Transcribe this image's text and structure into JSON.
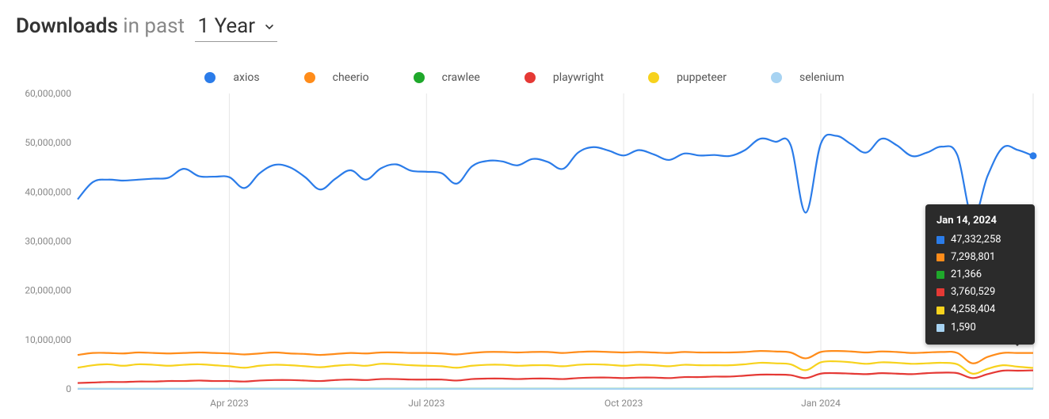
{
  "header": {
    "label_downloads": "Downloads",
    "label_in_past": "in past",
    "range_selected": "1 Year"
  },
  "legend": [
    {
      "name": "axios",
      "color": "#2b7ce9"
    },
    {
      "name": "cheerio",
      "color": "#ff8c1a"
    },
    {
      "name": "crawlee",
      "color": "#1fa82b"
    },
    {
      "name": "playwright",
      "color": "#e53935"
    },
    {
      "name": "puppeteer",
      "color": "#f7d21d"
    },
    {
      "name": "selenium",
      "color": "#a7d3f2"
    }
  ],
  "tooltip": {
    "date": "Jan 14, 2024",
    "rows": [
      {
        "color": "#2b7ce9",
        "value": "47,332,258"
      },
      {
        "color": "#ff8c1a",
        "value": "7,298,801"
      },
      {
        "color": "#1fa82b",
        "value": "21,366"
      },
      {
        "color": "#e53935",
        "value": "3,760,529"
      },
      {
        "color": "#f7d21d",
        "value": "4,258,404"
      },
      {
        "color": "#a7d3f2",
        "value": "1,590"
      }
    ]
  },
  "chart_data": {
    "type": "line",
    "xlabel": "",
    "ylabel": "",
    "ylim": [
      0,
      60000000
    ],
    "x_ticks": [
      "Apr 2023",
      "Jul 2023",
      "Oct 2023",
      "Jan 2024"
    ],
    "y_ticks": [
      0,
      10000000,
      20000000,
      30000000,
      40000000,
      50000000,
      60000000
    ],
    "series": [
      {
        "name": "axios",
        "color": "#2b7ce9",
        "values": [
          38500000,
          42000000,
          42500000,
          42300000,
          42500000,
          42700000,
          42900000,
          44700000,
          43200000,
          43100000,
          43000000,
          40800000,
          43800000,
          45500000,
          45000000,
          43000000,
          40500000,
          42700000,
          44400000,
          42500000,
          44800000,
          45600000,
          44300000,
          44100000,
          43800000,
          41700000,
          45200000,
          46300000,
          46200000,
          45400000,
          46700000,
          46100000,
          44700000,
          48000000,
          49100000,
          48400000,
          47400000,
          48500000,
          47600000,
          46500000,
          47800000,
          47400000,
          47500000,
          47300000,
          48500000,
          50800000,
          50200000,
          49600000,
          35800000,
          49800000,
          51400000,
          49700000,
          48000000,
          50800000,
          49500000,
          47300000,
          48000000,
          49200000,
          47500000,
          34800000,
          43300000,
          49000000,
          48500000,
          47332258
        ]
      },
      {
        "name": "cheerio",
        "color": "#ff8c1a",
        "values": [
          6900000,
          7300000,
          7300000,
          7200000,
          7400000,
          7300000,
          7200000,
          7300000,
          7400000,
          7300000,
          7200000,
          7000000,
          7200000,
          7400000,
          7200000,
          7100000,
          6900000,
          7100000,
          7300000,
          7200000,
          7400000,
          7400000,
          7300000,
          7300000,
          7200000,
          7000000,
          7300000,
          7500000,
          7500000,
          7400000,
          7500000,
          7500000,
          7300000,
          7500000,
          7600000,
          7500000,
          7400000,
          7500000,
          7400000,
          7300000,
          7500000,
          7400000,
          7400000,
          7400000,
          7500000,
          7700000,
          7600000,
          7400000,
          6200000,
          7500000,
          7700000,
          7600000,
          7400000,
          7600000,
          7500000,
          7300000,
          7400000,
          7500000,
          7300000,
          5200000,
          6500000,
          7300000,
          7300000,
          7298801
        ]
      },
      {
        "name": "puppeteer",
        "color": "#f7d21d",
        "values": [
          4300000,
          4800000,
          5000000,
          4700000,
          5000000,
          4900000,
          4700000,
          4900000,
          5000000,
          4800000,
          4600000,
          4300000,
          4700000,
          4900000,
          4800000,
          4600000,
          4400000,
          4700000,
          4900000,
          4700000,
          5100000,
          5000000,
          4800000,
          4700000,
          4600000,
          4300000,
          4700000,
          4900000,
          4900000,
          4700000,
          4800000,
          4800000,
          4600000,
          4900000,
          5000000,
          4900000,
          4700000,
          4900000,
          4800000,
          4600000,
          4900000,
          4800000,
          4800000,
          4800000,
          5000000,
          5300000,
          5200000,
          5000000,
          3800000,
          5400000,
          5600000,
          5400000,
          5100000,
          5400000,
          5300000,
          5100000,
          5200000,
          5300000,
          5000000,
          3100000,
          4100000,
          4800000,
          4500000,
          4258404
        ]
      },
      {
        "name": "playwright",
        "color": "#e53935",
        "values": [
          1200000,
          1300000,
          1400000,
          1400000,
          1500000,
          1500000,
          1600000,
          1600000,
          1700000,
          1600000,
          1600000,
          1500000,
          1700000,
          1800000,
          1800000,
          1700000,
          1600000,
          1800000,
          1900000,
          1800000,
          2000000,
          2000000,
          1900000,
          1900000,
          1900000,
          1700000,
          2000000,
          2100000,
          2100000,
          2000000,
          2100000,
          2100000,
          2000000,
          2200000,
          2300000,
          2300000,
          2200000,
          2300000,
          2300000,
          2200000,
          2400000,
          2400000,
          2500000,
          2500000,
          2700000,
          2900000,
          2900000,
          2800000,
          2200000,
          3100000,
          3200000,
          3100000,
          3000000,
          3200000,
          3100000,
          3000000,
          3200000,
          3300000,
          3200000,
          2200000,
          3000000,
          3700000,
          3700000,
          3760529
        ]
      },
      {
        "name": "crawlee",
        "color": "#1fa82b",
        "values": [
          12000,
          12000,
          12300,
          12500,
          12700,
          13000,
          13200,
          13400,
          13600,
          13800,
          14000,
          14200,
          14500,
          14700,
          15000,
          15200,
          15500,
          15700,
          16000,
          16200,
          16500,
          16700,
          17000,
          17200,
          17500,
          17700,
          18000,
          18200,
          18400,
          18600,
          18800,
          19000,
          19200,
          19400,
          19600,
          19800,
          20000,
          20100,
          20200,
          20300,
          20400,
          20500,
          20600,
          20700,
          20800,
          20900,
          21000,
          20500,
          16000,
          20800,
          21100,
          21000,
          20800,
          21100,
          21000,
          20800,
          21000,
          21200,
          21000,
          15000,
          18500,
          21100,
          21200,
          21366
        ]
      },
      {
        "name": "selenium",
        "color": "#a7d3f2",
        "values": [
          1400,
          1450,
          1500,
          1520,
          1550,
          1580,
          1600,
          1620,
          1650,
          1670,
          1700,
          1680,
          1720,
          1750,
          1730,
          1700,
          1680,
          1720,
          1750,
          1730,
          1780,
          1790,
          1770,
          1760,
          1740,
          1700,
          1760,
          1800,
          1800,
          1780,
          1800,
          1800,
          1770,
          1810,
          1830,
          1810,
          1790,
          1810,
          1800,
          1780,
          1810,
          1800,
          1800,
          1800,
          1820,
          1850,
          1840,
          1820,
          1450,
          1850,
          1870,
          1850,
          1820,
          1850,
          1840,
          1810,
          1830,
          1850,
          1820,
          1300,
          1550,
          1700,
          1650,
          1590
        ]
      }
    ],
    "tooltip_point_index": 63
  }
}
